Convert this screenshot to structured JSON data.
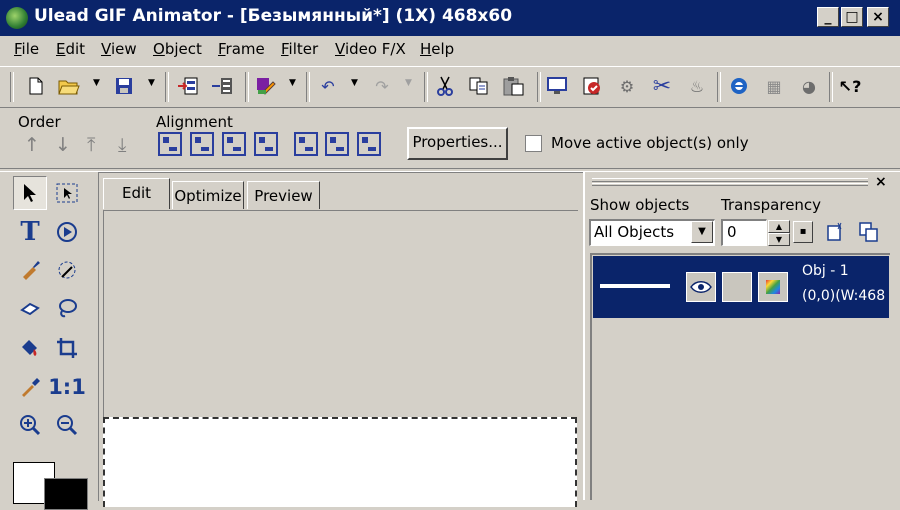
{
  "window": {
    "title": "Ulead GIF Animator - [Безымянный*] (1X) 468x60",
    "controls": {
      "minimize": "_",
      "maximize": "□",
      "close": "×"
    }
  },
  "menu": [
    "File",
    "Edit",
    "View",
    "Object",
    "Frame",
    "Filter",
    "Video F/X",
    "Help"
  ],
  "toolbar": {
    "icons": [
      "new-file-icon",
      "open-folder-icon",
      "save-icon",
      "import-frames-icon",
      "export-frames-icon",
      "paint-icon",
      "undo-icon",
      "redo-icon",
      "cut-icon",
      "copy-icon",
      "paste-icon",
      "preview-icon",
      "tutorial-icon",
      "gear-icon",
      "crop-icon",
      "optimize-icon",
      "internet-explorer-icon",
      "web-icon",
      "globe-icon",
      "context-help-icon"
    ],
    "context_help_glyph": "?"
  },
  "order": {
    "label": "Order"
  },
  "alignment": {
    "label": "Alignment"
  },
  "properties_button": "Properties...",
  "move_active_label": "Move active object(s) only",
  "tools": {
    "text_glyph": "T",
    "actual_size_glyph": "1:1"
  },
  "tabs": [
    "Edit",
    "Optimize",
    "Preview"
  ],
  "objects_panel": {
    "show_label": "Show objects",
    "show_value": "All Objects",
    "transparency_label": "Transparency",
    "transparency_value": "0",
    "close_glyph": "×",
    "object": {
      "name": "Obj - 1",
      "info": "(0,0)(W:468"
    }
  },
  "colors": {
    "titlebar": "#0a246a",
    "face": "#d4d0c8",
    "selection": "#0a246a"
  }
}
